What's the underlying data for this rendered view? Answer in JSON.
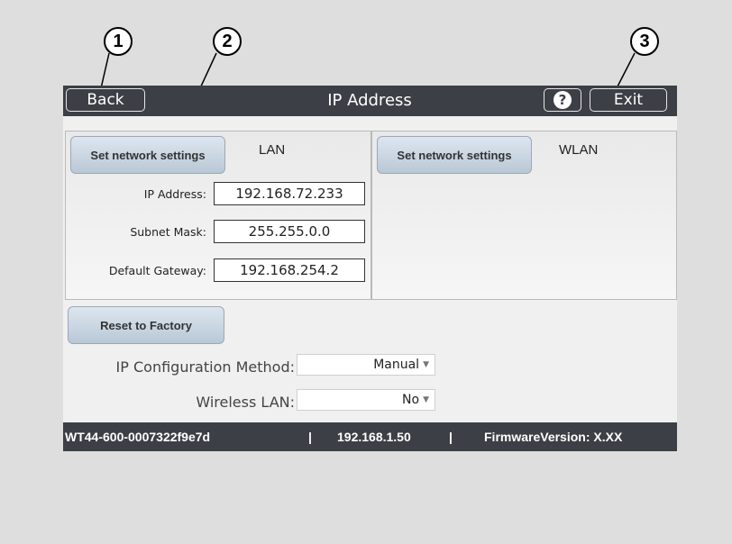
{
  "callouts": [
    "1",
    "2",
    "3"
  ],
  "titlebar": {
    "back_label": "Back",
    "title": "IP Address",
    "help_label": "?",
    "exit_label": "Exit"
  },
  "lan": {
    "button_label": "Set network settings",
    "section_label": "LAN",
    "ip_label": "IP Address:",
    "ip_value": "192.168.72.233",
    "subnet_label": "Subnet Mask:",
    "subnet_value": "255.255.0.0",
    "gateway_label": "Default Gateway:",
    "gateway_value": "192.168.254.2"
  },
  "wlan": {
    "button_label": "Set network settings",
    "section_label": "WLAN"
  },
  "reset_label": "Reset to Factory",
  "ip_config": {
    "label": "IP Configuration Method:",
    "value": "Manual"
  },
  "wireless": {
    "label": "Wireless LAN:",
    "value": "No"
  },
  "statusbar": {
    "device_id": "WT44-600-0007322f9e7d",
    "separator": "|",
    "ip": "192.168.1.50",
    "firmware": "FirmwareVersion: X.XX"
  },
  "colors": {
    "bar": "#3c3f45",
    "button_gradient_top": "#dde6ef",
    "button_gradient_bottom": "#b9c8d6"
  }
}
